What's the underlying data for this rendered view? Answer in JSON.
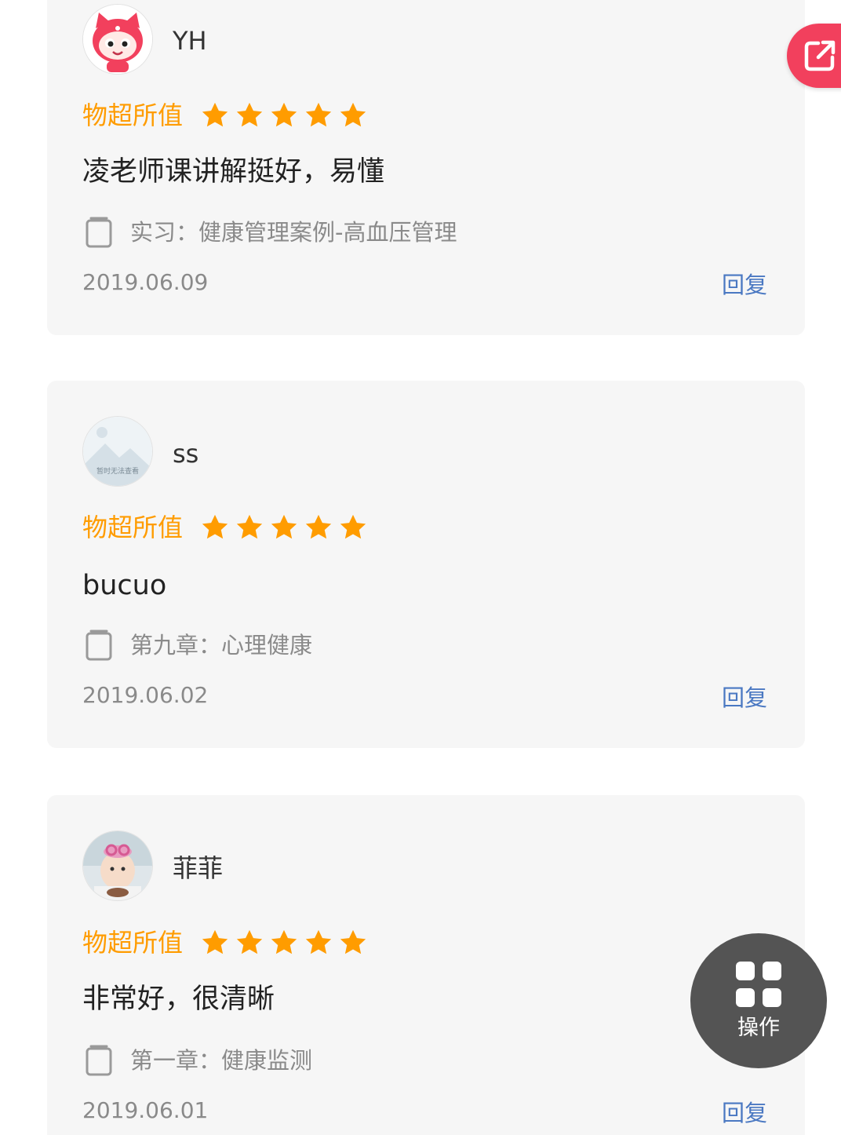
{
  "reviews": [
    {
      "username": "YH",
      "avatar": "cartoon-cat-avatar",
      "rating_label": "物超所值",
      "stars": 5,
      "comment": "凌老师课讲解挺好，易懂",
      "chapter": "实习：健康管理案例-高血压管理",
      "date": "2019.06.09",
      "reply_label": "回复"
    },
    {
      "username": "ss",
      "avatar": "placeholder-mountain-avatar",
      "avatar_text": "暂时无法查看",
      "rating_label": "物超所值",
      "stars": 5,
      "comment": "bucuo",
      "chapter": "第九章：心理健康",
      "date": "2019.06.02",
      "reply_label": "回复"
    },
    {
      "username": "菲菲",
      "avatar": "baby-photo-avatar",
      "rating_label": "物超所值",
      "stars": 5,
      "comment": "非常好，很清晰",
      "chapter": "第一章：健康监测",
      "date": "2019.06.01",
      "reply_label": "回复"
    }
  ],
  "floating": {
    "share_icon": "external-link-icon",
    "operate_icon": "grid-icon",
    "operate_label": "操作"
  },
  "colors": {
    "accent_orange": "#ff9c00",
    "reply_blue": "#4a78c2",
    "share_red": "#f2405d",
    "card_bg": "#f6f6f6"
  }
}
